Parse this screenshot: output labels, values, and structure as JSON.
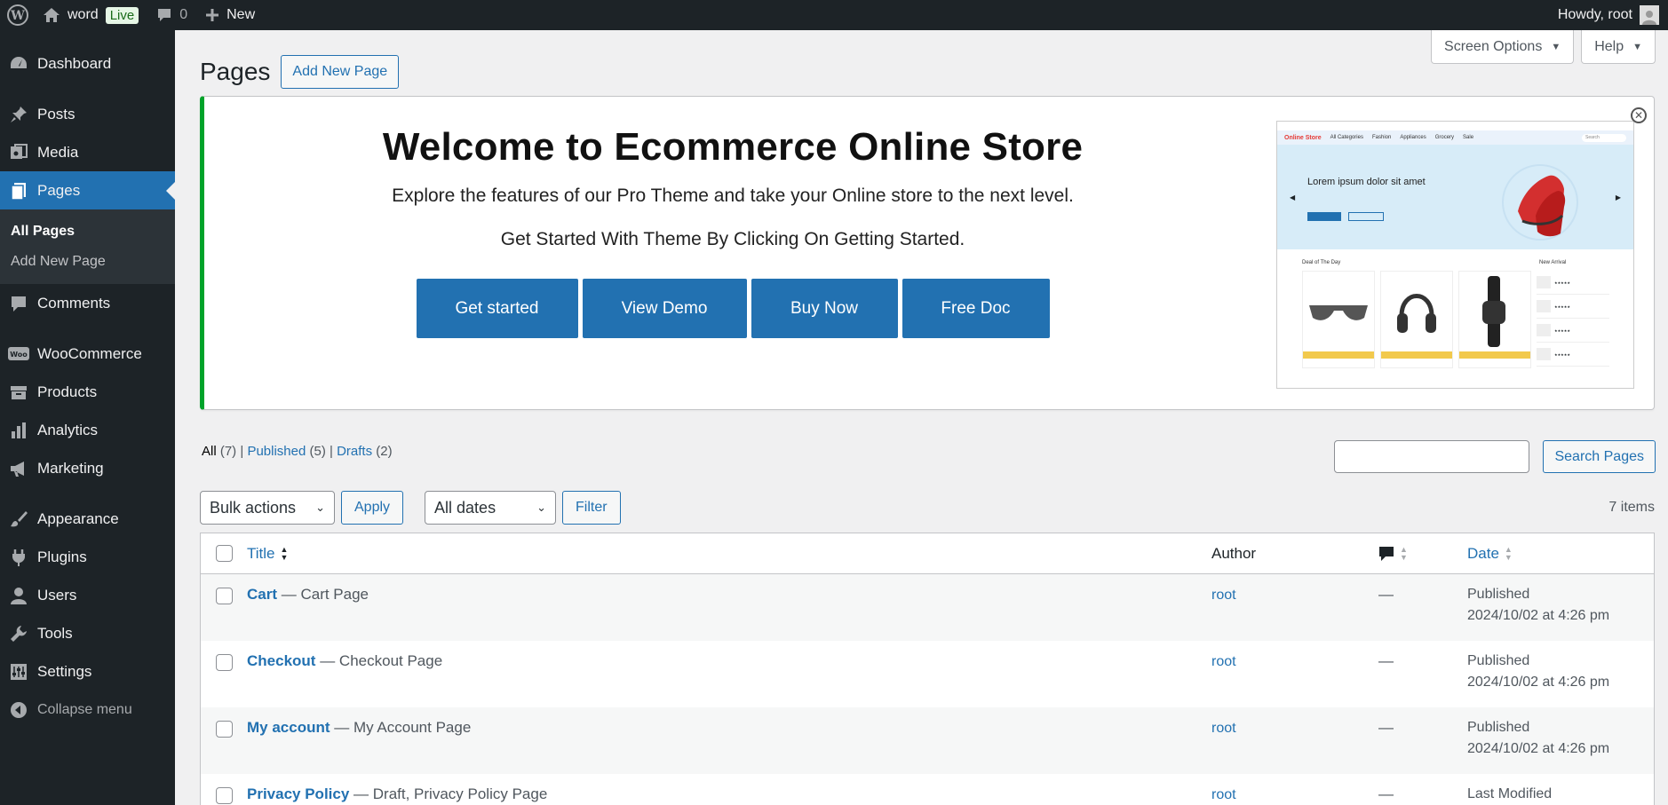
{
  "adminbar": {
    "site_name": "word",
    "live_badge": "Live",
    "comments_count": "0",
    "new_label": "New",
    "howdy": "Howdy, root"
  },
  "sidebar": {
    "items": [
      {
        "label": "Dashboard",
        "icon": "dashboard-icon"
      },
      {
        "label": "Posts",
        "icon": "pin-icon"
      },
      {
        "label": "Media",
        "icon": "media-icon"
      },
      {
        "label": "Pages",
        "icon": "pages-icon"
      },
      {
        "label": "Comments",
        "icon": "comment-icon"
      },
      {
        "label": "WooCommerce",
        "icon": "woo-icon"
      },
      {
        "label": "Products",
        "icon": "archive-icon"
      },
      {
        "label": "Analytics",
        "icon": "bar-chart-icon"
      },
      {
        "label": "Marketing",
        "icon": "megaphone-icon"
      },
      {
        "label": "Appearance",
        "icon": "brush-icon"
      },
      {
        "label": "Plugins",
        "icon": "plug-icon"
      },
      {
        "label": "Users",
        "icon": "user-icon"
      },
      {
        "label": "Tools",
        "icon": "wrench-icon"
      },
      {
        "label": "Settings",
        "icon": "settings-icon"
      },
      {
        "label": "Collapse menu",
        "icon": "collapse-icon"
      }
    ],
    "submenu": [
      "All Pages",
      "Add New Page"
    ]
  },
  "screen_meta": {
    "screen_options": "Screen Options",
    "help": "Help"
  },
  "header": {
    "title": "Pages",
    "add_new": "Add New Page"
  },
  "notice": {
    "title": "Welcome to Ecommerce Online Store",
    "text": "Explore the features of our Pro Theme and take your Online store to the next level.",
    "text2": "Get Started With Theme By Clicking On Getting Started.",
    "buttons": [
      "Get started",
      "View Demo",
      "Buy Now",
      "Free Doc"
    ],
    "preview": {
      "store_name": "Online Store",
      "nav": [
        "All Categories",
        "Fashion",
        "Appliances",
        "Grocery",
        "Sale"
      ],
      "search": "Search",
      "hero_title": "Lorem ipsum dolor sit amet",
      "deal": "Deal of The Day",
      "new_arrival": "New Arrival"
    }
  },
  "filters": {
    "all": "All",
    "all_count": "(7)",
    "published": "Published",
    "published_count": "(5)",
    "drafts": "Drafts",
    "drafts_count": "(2)",
    "search_button": "Search Pages",
    "bulk_actions": "Bulk actions",
    "apply": "Apply",
    "all_dates": "All dates",
    "filter": "Filter",
    "items_count": "7 items"
  },
  "table": {
    "columns": {
      "title": "Title",
      "author": "Author",
      "date": "Date"
    },
    "rows": [
      {
        "title": "Cart",
        "state": "— Cart Page",
        "author": "root",
        "comments": "—",
        "status": "Published",
        "date": "2024/10/02 at 4:26 pm"
      },
      {
        "title": "Checkout",
        "state": "— Checkout Page",
        "author": "root",
        "comments": "—",
        "status": "Published",
        "date": "2024/10/02 at 4:26 pm"
      },
      {
        "title": "My account",
        "state": "— My Account Page",
        "author": "root",
        "comments": "—",
        "status": "Published",
        "date": "2024/10/02 at 4:26 pm"
      },
      {
        "title": "Privacy Policy",
        "state": "— Draft, Privacy Policy Page",
        "author": "root",
        "comments": "—",
        "status": "Last Modified",
        "date": ""
      }
    ]
  },
  "colors": {
    "accent": "#2271b1",
    "admin_dark": "#1d2327",
    "notice_border": "#00a32a"
  }
}
